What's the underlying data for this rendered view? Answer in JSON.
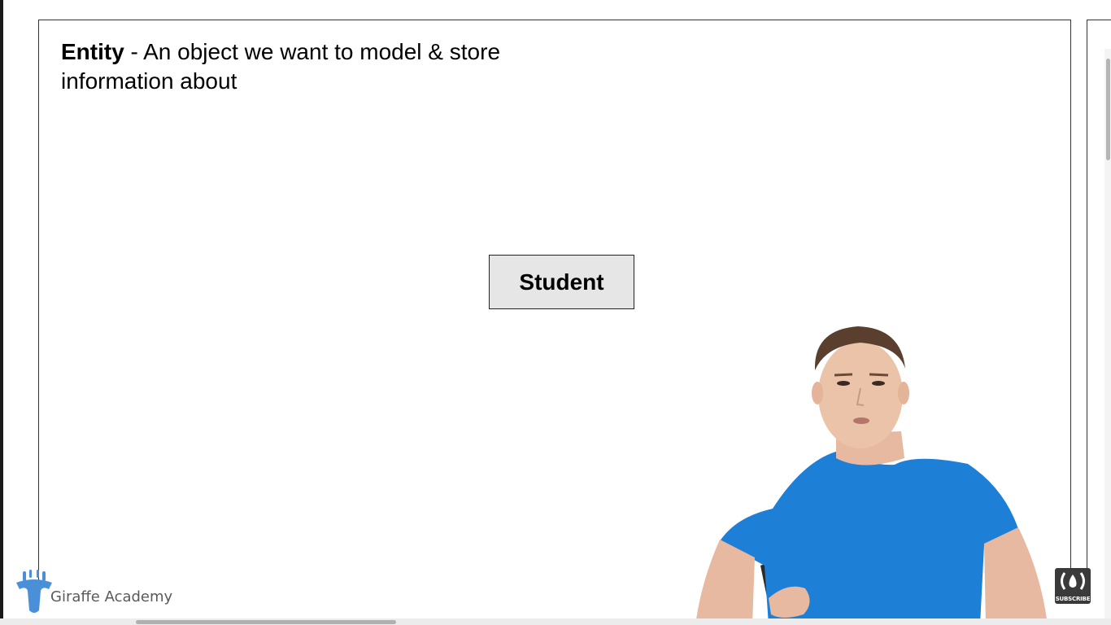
{
  "slide": {
    "heading_term": "Entity",
    "heading_rest": " - An object we want to model & store information about",
    "entity_label": "Student"
  },
  "branding": {
    "channel_name": "Giraffe Academy",
    "logo_icon": "giraffe-icon",
    "logo_color": "#4a90d9"
  },
  "subscribe": {
    "label": "SUBSCRIBE",
    "icon": "freecodecamp-icon"
  },
  "presenter": {
    "shirt_color": "#1e7fd6"
  }
}
